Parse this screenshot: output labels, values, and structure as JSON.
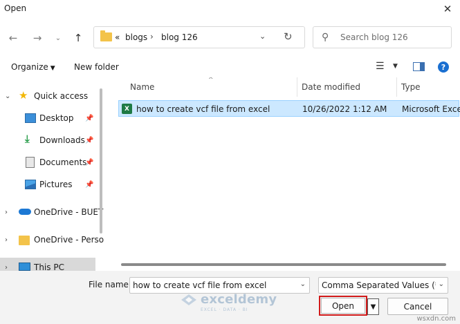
{
  "window": {
    "title": "Open"
  },
  "address": {
    "root_sep": "«",
    "crumbs": [
      "blogs",
      "blog 126"
    ],
    "sep": "›"
  },
  "search": {
    "placeholder": "Search blog 126"
  },
  "toolbar": {
    "organize": "Organize",
    "new_folder": "New folder"
  },
  "nav": {
    "items": [
      {
        "label": "Quick access",
        "icon": "star-icon",
        "pinned": false
      },
      {
        "label": "Desktop",
        "icon": "desktop-icon",
        "pinned": true
      },
      {
        "label": "Downloads",
        "icon": "download-icon",
        "pinned": true
      },
      {
        "label": "Documents",
        "icon": "documents-icon",
        "pinned": true
      },
      {
        "label": "Pictures",
        "icon": "pictures-icon",
        "pinned": true
      },
      {
        "label": "OneDrive - BUET",
        "icon": "cloud-icon",
        "pinned": false
      },
      {
        "label": "OneDrive - Perso",
        "icon": "folder-icon",
        "pinned": false
      },
      {
        "label": "This PC",
        "icon": "monitor-icon",
        "pinned": false
      }
    ]
  },
  "files": {
    "columns": [
      "Name",
      "Date modified",
      "Type"
    ],
    "rows": [
      {
        "name": "how to create vcf file from excel",
        "date": "10/26/2022 1:12 AM",
        "type": "Microsoft Excel"
      }
    ]
  },
  "footer": {
    "file_name_label": "File name:",
    "file_name_value": "how to create vcf file from excel",
    "file_type": "Comma Separated Values (*.CSV)",
    "open_label": "Open",
    "cancel_label": "Cancel"
  },
  "watermark": {
    "name": "exceldemy",
    "tagline": "EXCEL · DATA · BI"
  },
  "corner": "wsxdn.com",
  "colors": {
    "selection": "#cce8ff",
    "highlight": "#d11a1a",
    "accent": "#1a6fd1"
  }
}
